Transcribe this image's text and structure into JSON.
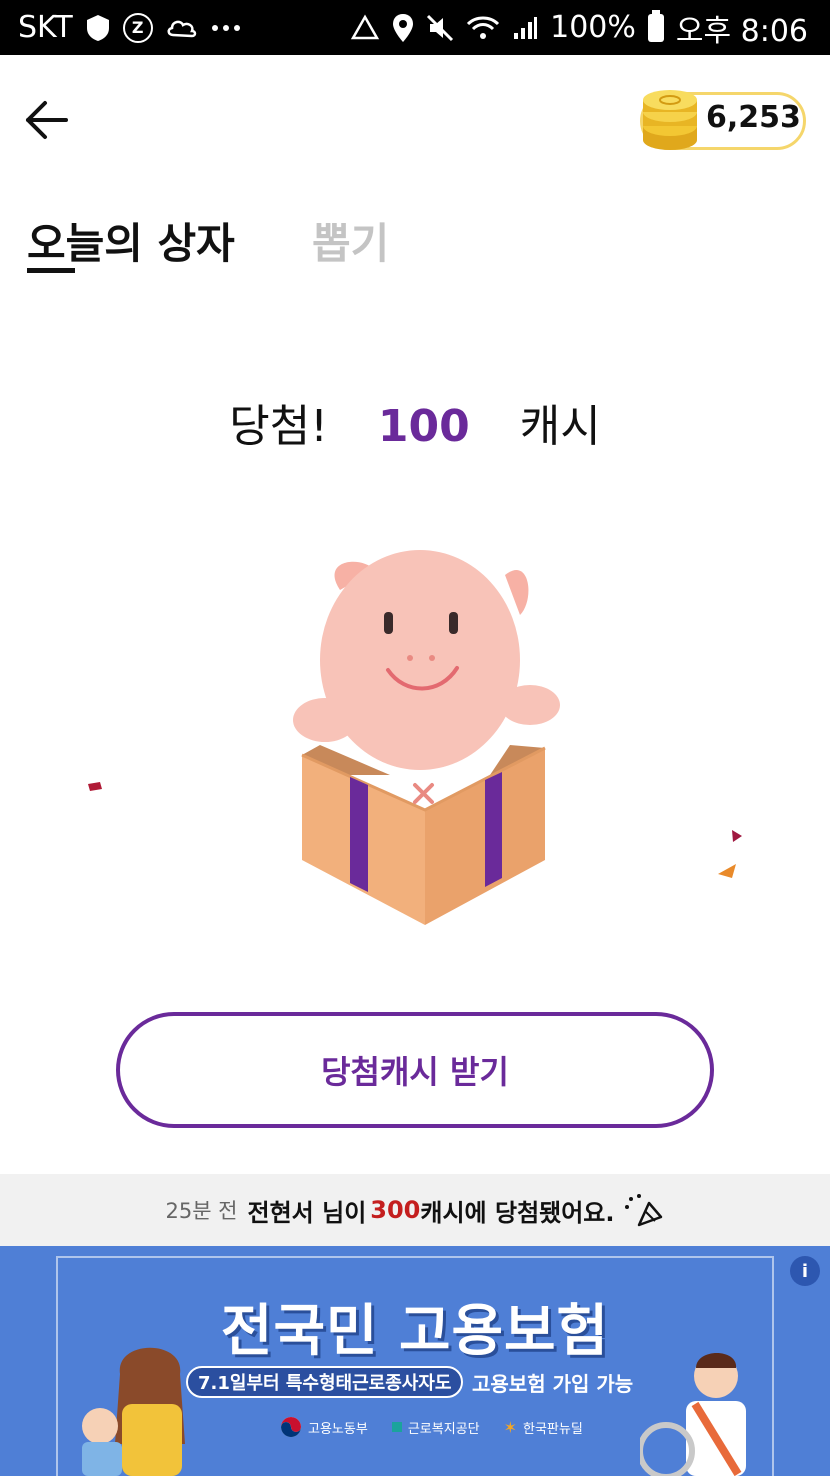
{
  "statusbar": {
    "carrier": "SKT",
    "battery": "100%",
    "time": "오후 8:06",
    "icons": [
      "shield-icon",
      "z-icon",
      "cloud-icon",
      "more-icon",
      "recycle-icon",
      "location-icon",
      "mute-icon",
      "wifi-icon",
      "signal-icon",
      "battery-icon"
    ]
  },
  "header": {
    "back_icon": "arrow-left-icon",
    "coin_icon": "coin-stack-icon",
    "coin_count": "6,253"
  },
  "tabs": [
    {
      "label": "오늘의 상자",
      "active": true
    },
    {
      "label": "뽑기",
      "active": false
    }
  ],
  "result": {
    "prefix": "당첨!",
    "amount": "100",
    "unit": "캐시",
    "amount_color": "#6a2a9a"
  },
  "claim_button": {
    "label": "당첨캐시 받기"
  },
  "ticker": {
    "time": "25분 전",
    "name_part": "전현서 님이",
    "amount": "300",
    "suffix": "캐시에 당첨됐어요.",
    "icon": "party-popper-icon"
  },
  "ad": {
    "title": "전국민 고용보험",
    "pill": "7.1일부터 특수형태근로종사자도",
    "sub": "고용보험 가입 가능",
    "logos": [
      "고용노동부",
      "근로복지공단",
      "한국판뉴딜"
    ],
    "info_icon": "info-icon"
  },
  "colors": {
    "accent": "#6a2a9a",
    "highlight": "#c41e1e",
    "ad_bg": "#4f7fd6"
  }
}
